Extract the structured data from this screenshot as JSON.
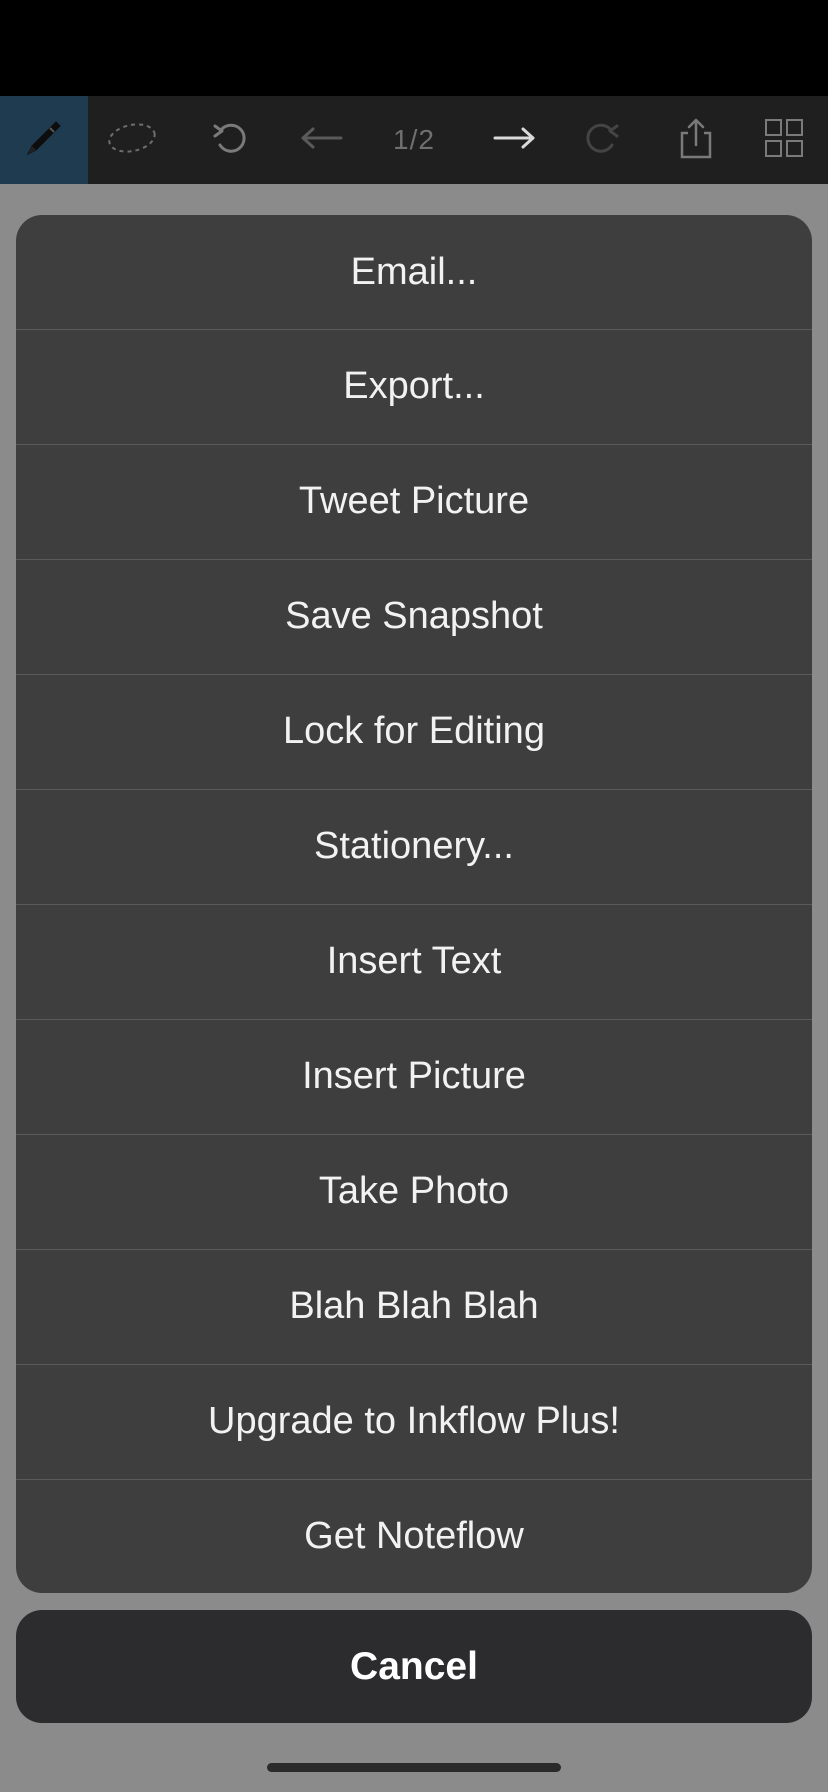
{
  "toolbar": {
    "pen_icon": "pen-icon",
    "lasso_icon": "lasso-icon",
    "undo_icon": "undo-icon",
    "prev_icon": "arrow-left-icon",
    "page_indicator": "1/2",
    "next_icon": "arrow-right-icon",
    "redo_icon": "redo-icon",
    "share_icon": "share-icon",
    "grid_icon": "grid-icon",
    "active_tool": "pen"
  },
  "action_sheet": {
    "items": [
      {
        "label": "Email..."
      },
      {
        "label": "Export..."
      },
      {
        "label": "Tweet Picture"
      },
      {
        "label": "Save Snapshot"
      },
      {
        "label": "Lock for Editing"
      },
      {
        "label": "Stationery..."
      },
      {
        "label": "Insert Text"
      },
      {
        "label": "Insert Picture"
      },
      {
        "label": "Take Photo"
      },
      {
        "label": "Blah Blah Blah"
      },
      {
        "label": "Upgrade to Inkflow Plus!"
      },
      {
        "label": "Get Noteflow"
      }
    ],
    "cancel_label": "Cancel"
  },
  "colors": {
    "sheet_bg": "#3e3e3e",
    "cancel_bg": "#2c2c2e",
    "toolbar_bg": "#1f1f1f",
    "active_tool_bg": "#1f3b50"
  }
}
